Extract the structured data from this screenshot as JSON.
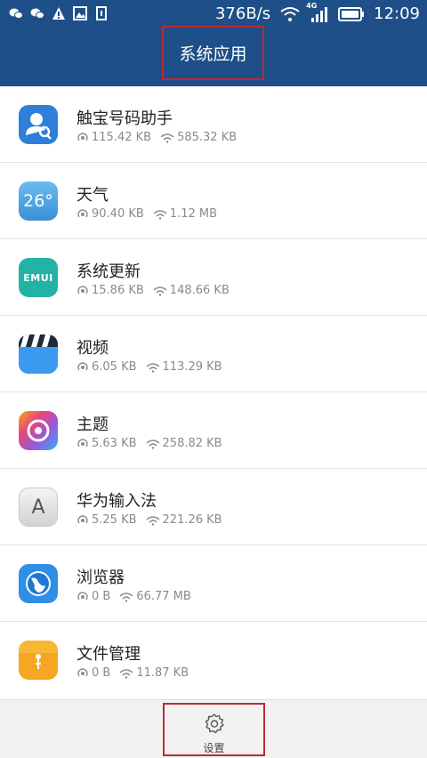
{
  "status_bar": {
    "net_speed": "376B/s",
    "network_type": "4G",
    "time": "12:09",
    "icons": [
      "wechat-icon",
      "wechat-icon",
      "warning-icon",
      "image-icon",
      "sim-icon",
      "wifi-icon",
      "signal-icon",
      "battery-icon"
    ]
  },
  "header": {
    "title": "系统应用"
  },
  "apps": [
    {
      "name": "触宝号码助手",
      "mobile": "115.42 KB",
      "wifi": "585.32 KB",
      "icon": "contact-search-icon",
      "color": "#2f7ed8"
    },
    {
      "name": "天气",
      "mobile": "90.40 KB",
      "wifi": "1.12 MB",
      "icon": "weather-icon",
      "color": "#4ea7e6",
      "icon_text": "26°"
    },
    {
      "name": "系统更新",
      "mobile": "15.86 KB",
      "wifi": "148.66 KB",
      "icon": "emui-update-icon",
      "color": "#22b3a6",
      "icon_text": "EMUI"
    },
    {
      "name": "视频",
      "mobile": "6.05 KB",
      "wifi": "113.29 KB",
      "icon": "video-clapper-icon",
      "color": "#2f8ee6"
    },
    {
      "name": "主题",
      "mobile": "5.63 KB",
      "wifi": "258.82 KB",
      "icon": "theme-icon",
      "color": "#e85a8c"
    },
    {
      "name": "华为输入法",
      "mobile": "5.25 KB",
      "wifi": "221.26 KB",
      "icon": "keyboard-a-icon",
      "color": "#dcdcdc",
      "icon_text": "A"
    },
    {
      "name": "浏览器",
      "mobile": "0 B",
      "wifi": "66.77 MB",
      "icon": "browser-globe-icon",
      "color": "#2f8ee6"
    },
    {
      "name": "文件管理",
      "mobile": "0 B",
      "wifi": "11.87 KB",
      "icon": "file-manager-icon",
      "color": "#f5a623"
    }
  ],
  "bottom_bar": {
    "settings_label": "设置",
    "settings_icon": "gear-icon"
  },
  "colors": {
    "header_bg": "#1f4f88",
    "highlight_border": "#c0282f"
  }
}
